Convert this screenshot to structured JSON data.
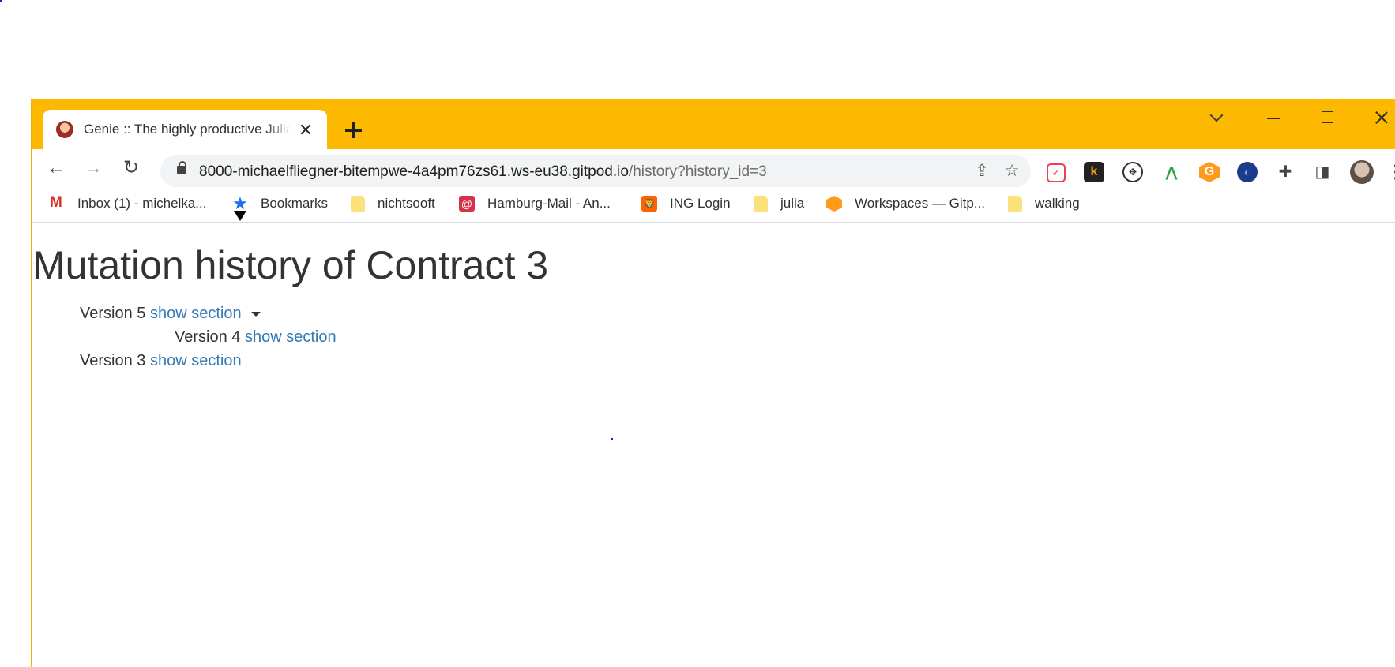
{
  "browser": {
    "tab_title": "Genie :: The highly productive Julia web framework",
    "url_host": "8000-michaelfliegner-bitempwe-4a4pm76zs61.ws-eu38.gitpod.io",
    "url_path": "/history?history_id=3",
    "accent_color": "#fdb800"
  },
  "bookmarks": [
    {
      "label": "Inbox (1) - michelka...",
      "icon": "gmail-icon"
    },
    {
      "label": "Bookmarks",
      "icon": "star-icon"
    },
    {
      "label": "nichtsooft",
      "icon": "folder-icon"
    },
    {
      "label": "Hamburg-Mail - An...",
      "icon": "at-icon"
    },
    {
      "label": "ING Login",
      "icon": "ing-icon"
    },
    {
      "label": "julia",
      "icon": "folder-icon"
    },
    {
      "label": "Workspaces — Gitp...",
      "icon": "gitpod-icon"
    },
    {
      "label": "walking",
      "icon": "folder-icon"
    }
  ],
  "page": {
    "title": "Mutation history of Contract 3",
    "versions": [
      {
        "label": "Version 5",
        "link": "show section"
      },
      {
        "label": "Version 4",
        "link": "show section"
      },
      {
        "label": "Version 3",
        "link": "show section"
      }
    ]
  }
}
